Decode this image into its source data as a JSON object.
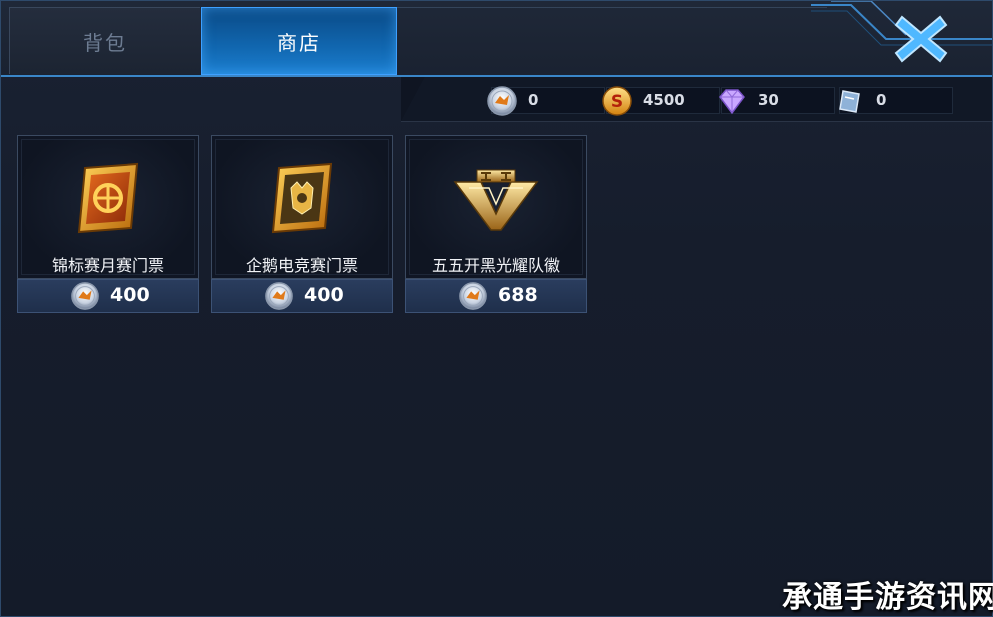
{
  "tabs": [
    {
      "label": "背包",
      "active": false
    },
    {
      "label": "商店",
      "active": true
    }
  ],
  "currencies": [
    {
      "icon": "ticket-coin-icon",
      "value": "0"
    },
    {
      "icon": "gold-coin-icon",
      "value": "4500"
    },
    {
      "icon": "diamond-icon",
      "value": "30"
    },
    {
      "icon": "voucher-card-icon",
      "value": "0"
    }
  ],
  "items": [
    {
      "name": "锦标赛月赛门票",
      "price": "400",
      "icon": "tournament-ticket-icon",
      "price_icon": "ticket-coin-icon"
    },
    {
      "name": "企鹅电竞赛门票",
      "price": "400",
      "icon": "esports-ticket-icon",
      "price_icon": "ticket-coin-icon"
    },
    {
      "name": "五五开黑光耀队徽",
      "price": "688",
      "icon": "team-badge-icon",
      "price_icon": "ticket-coin-icon"
    }
  ],
  "watermark": "承通手游资讯网",
  "colors": {
    "accent": "#3a86c8",
    "active_tab": "#1167b0",
    "background": "#161d2c",
    "close": "#4fb8ff"
  }
}
